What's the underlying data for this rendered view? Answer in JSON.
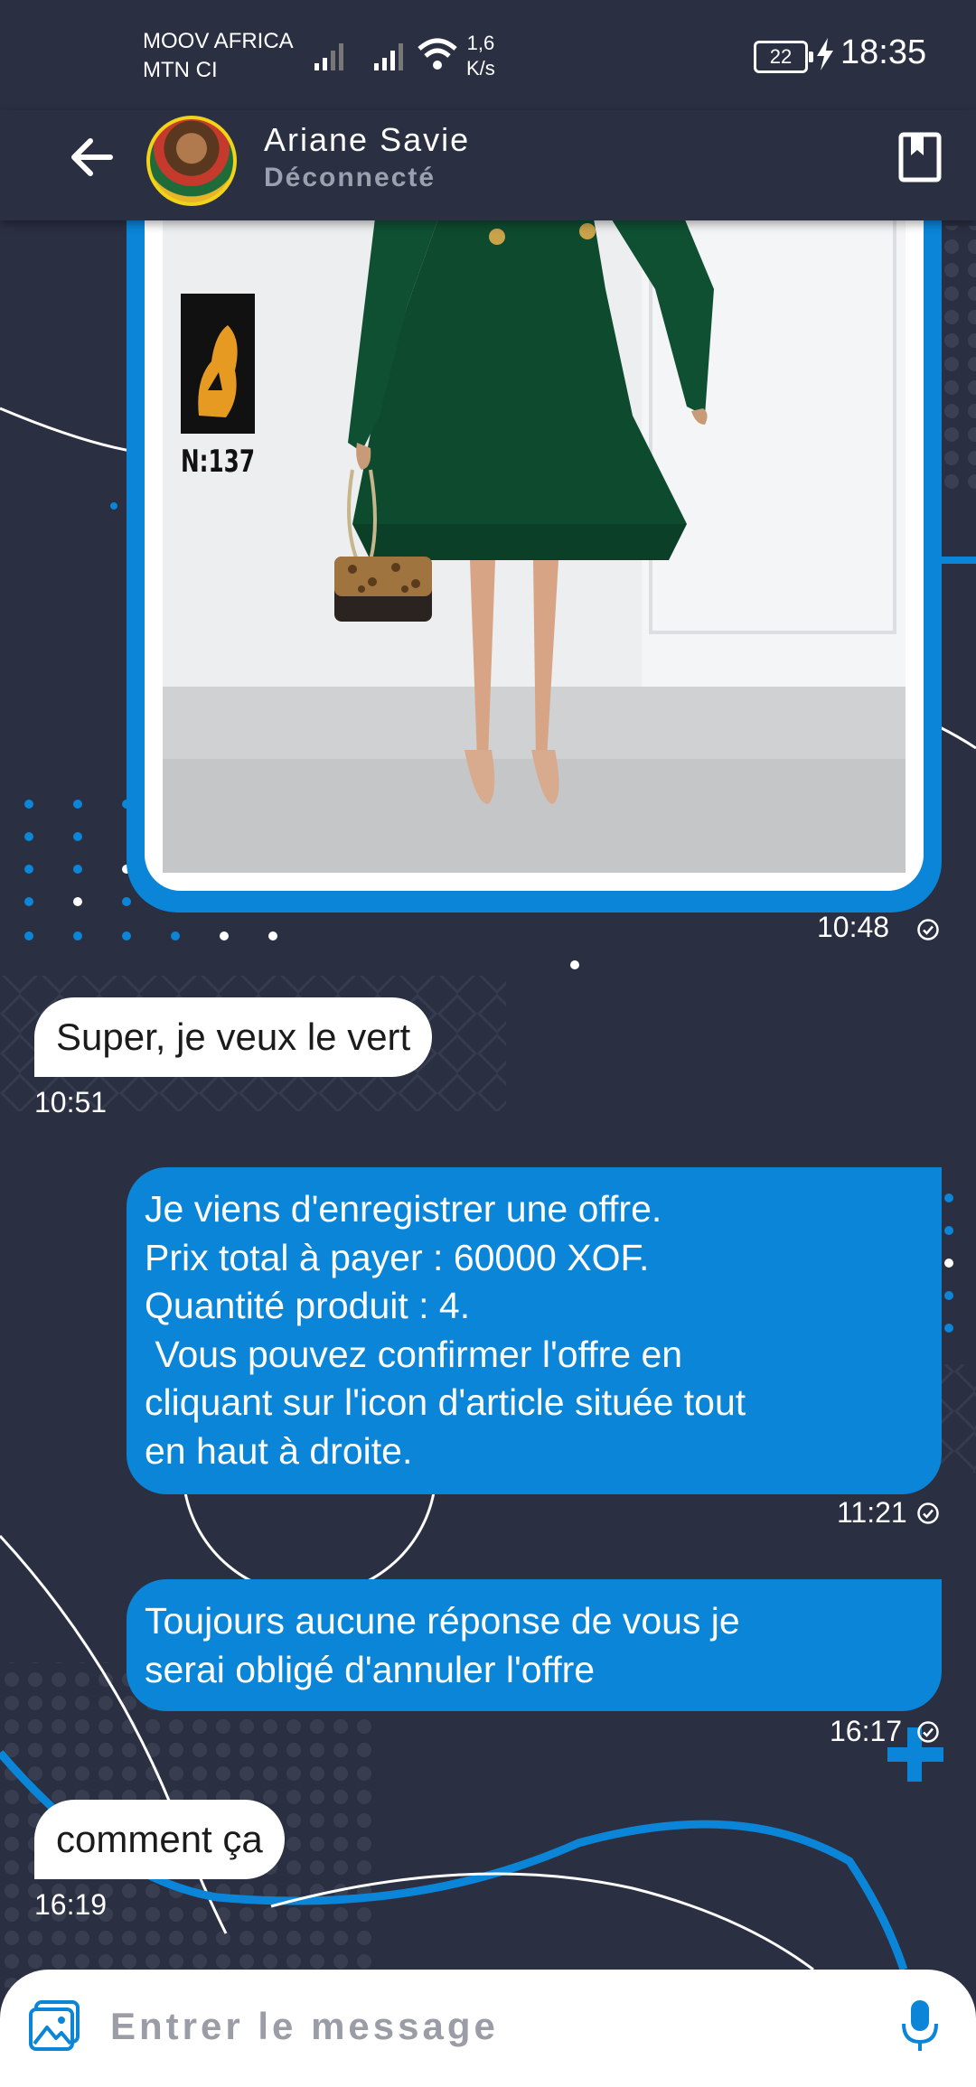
{
  "status_bar": {
    "carrier_line1": "MOOV AFRICA",
    "carrier_line2": "MTN CI",
    "net_speed_value": "1,6",
    "net_speed_unit": "K/s",
    "battery_level": "22",
    "time": "18:35"
  },
  "header": {
    "contact_name": "Ariane Savie",
    "contact_status": "Déconnecté",
    "back_icon": "arrow-left-icon",
    "offer_icon": "article-icon"
  },
  "product_image": {
    "label": "N:137",
    "time": "10:48"
  },
  "messages": [
    {
      "direction": "in",
      "text": "Super, je veux le vert",
      "time": "10:51"
    },
    {
      "direction": "out",
      "lines": [
        "Je viens d'enregistrer une offre.",
        "Prix total à payer : 60000 XOF.",
        "Quantité produit : 4.",
        " Vous pouvez confirmer l'offre en",
        "cliquant sur l'icon d'article située tout",
        "en haut à droite."
      ],
      "time": "11:21"
    },
    {
      "direction": "out",
      "lines": [
        "Toujours aucune réponse de vous je",
        "serai obligé d'annuler l'offre"
      ],
      "time": "16:17"
    },
    {
      "direction": "in",
      "text": "comment ça",
      "time": "16:19"
    }
  ],
  "input": {
    "placeholder": "Entrer le message",
    "gallery_icon": "image-gallery-icon",
    "mic_icon": "microphone-icon"
  },
  "colors": {
    "background": "#2a2f42",
    "outgoing_bubble": "#0a85d8",
    "incoming_bubble": "#ffffff",
    "avatar_ring": "#f1d417"
  }
}
